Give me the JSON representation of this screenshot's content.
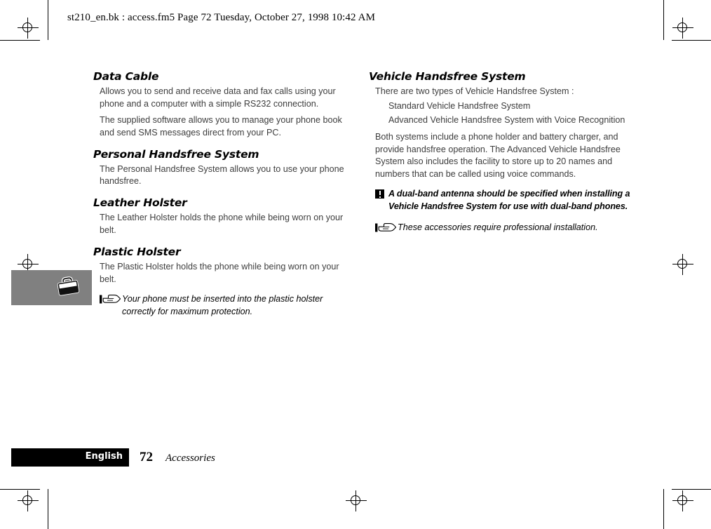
{
  "header": {
    "running_head": "st210_en.bk : access.fm5  Page 72  Tuesday, October 27, 1998  10:42 AM"
  },
  "left_column": {
    "sections": [
      {
        "heading": "Data Cable",
        "paragraphs": [
          "Allows you to send and receive data and fax calls using your phone and a computer with a simple RS232 connection.",
          "The supplied software allows you to manage your phone book and send SMS messages direct from your PC."
        ]
      },
      {
        "heading": "Personal Handsfree System",
        "paragraphs": [
          "The Personal Handsfree System allows you to use your phone handsfree."
        ]
      },
      {
        "heading": "Leather Holster",
        "paragraphs": [
          "The Leather Holster holds the phone while being worn on your belt."
        ]
      },
      {
        "heading": "Plastic Holster",
        "paragraphs": [
          "The Plastic Holster holds the phone while being worn on your belt."
        ]
      }
    ],
    "note": {
      "icon": "pointing-hand-icon",
      "text": "Your phone must be inserted into the plastic holster correctly for maximum protection."
    }
  },
  "right_column": {
    "heading": "Vehicle Handsfree System",
    "intro": "There are two types of Vehicle Handsfree System :",
    "types": [
      "Standard Vehicle Handsfree System",
      "Advanced Vehicle Handsfree System with Voice Recognition"
    ],
    "body": "Both systems include a phone holder and battery charger, and provide handsfree operation. The Advanced Vehicle Handsfree System also includes the facility to store up to 20 names and numbers that can be called using voice commands.",
    "warning": {
      "icon": "exclamation-warning-icon",
      "text": "A dual-band antenna should be specified when installing a Vehicle Handsfree System for use with dual-band phones."
    },
    "note": {
      "icon": "pointing-hand-icon",
      "text": "These accessories require professional installation."
    }
  },
  "thumb_tab": {
    "icon": "briefcase-bag-icon"
  },
  "footer": {
    "language": "English",
    "page_number": "72",
    "chapter": "Accessories"
  },
  "colors": {
    "tab_gray": "#808080",
    "footer_bar": "#000000",
    "body_text": "#3d3d3d"
  }
}
